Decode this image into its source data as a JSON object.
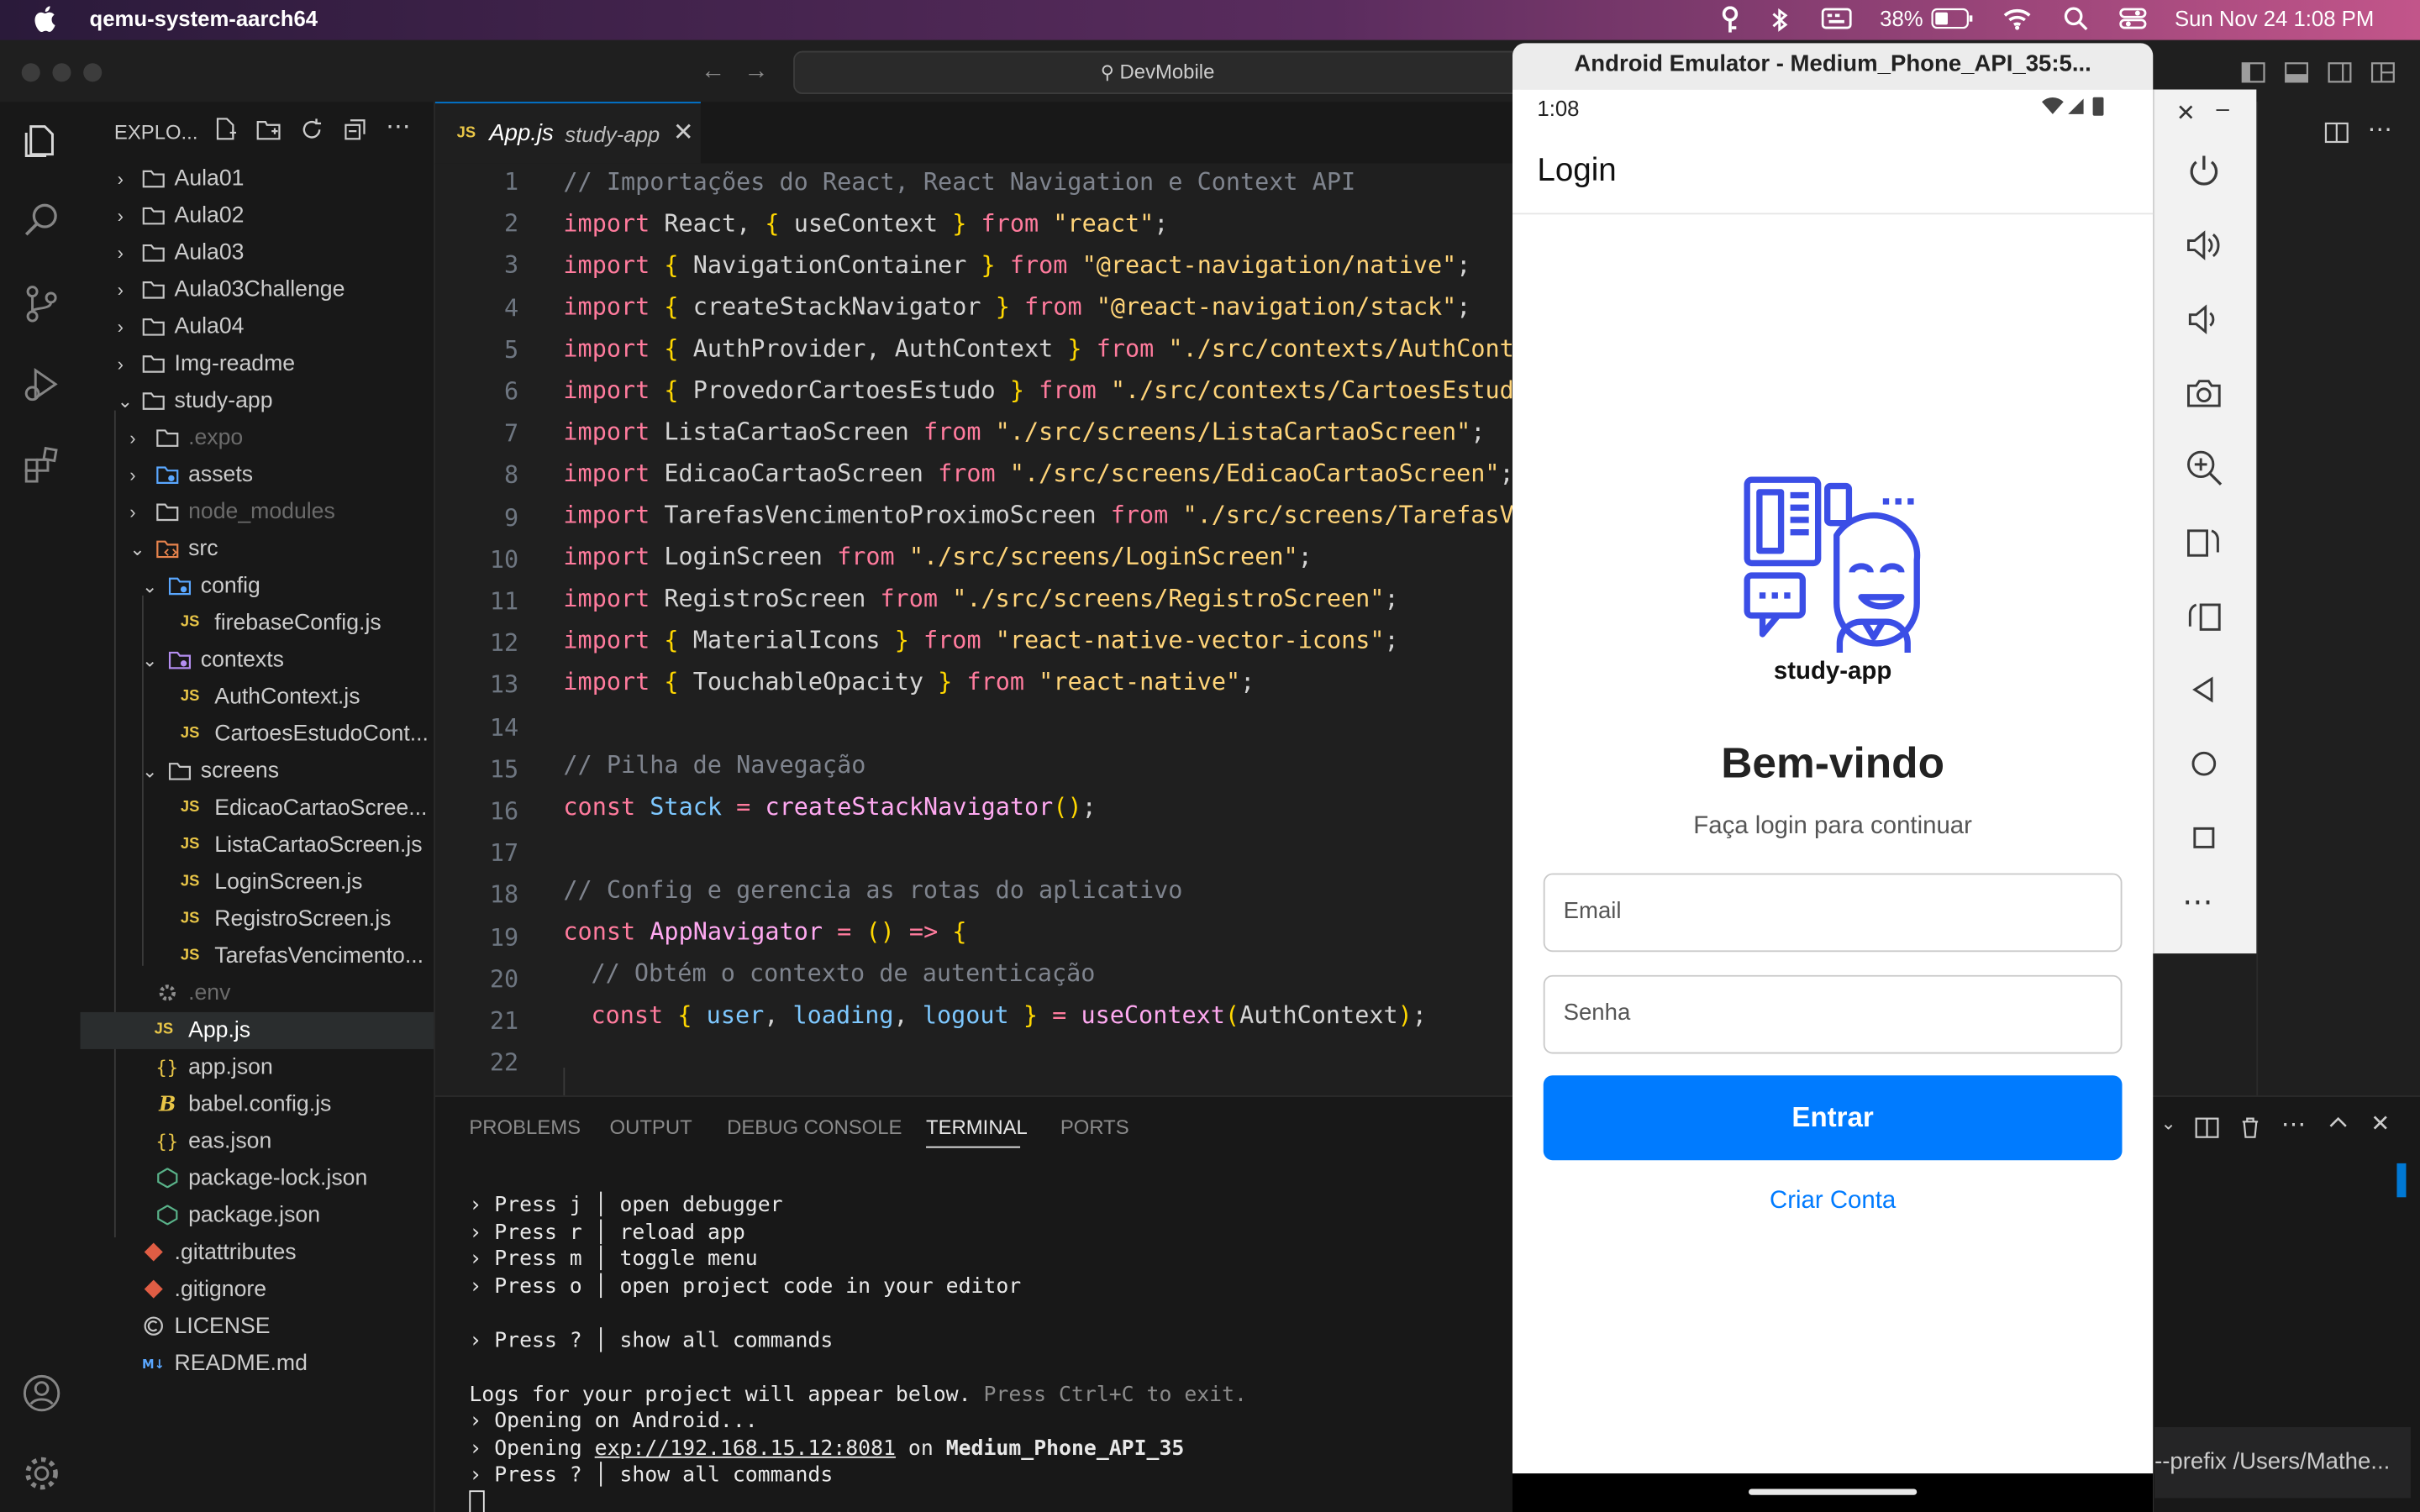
{
  "menubar": {
    "app_name": "qemu-system-aarch64",
    "battery": "38%",
    "clock": "Sun Nov 24  1:08 PM"
  },
  "vscode": {
    "command_center": "DevMobile",
    "explorer_header": "EXPLO...",
    "tree": [
      {
        "label": "Aula01"
      },
      {
        "label": "Aula02"
      },
      {
        "label": "Aula03"
      },
      {
        "label": "Aula03Challenge"
      },
      {
        "label": "Aula04"
      },
      {
        "label": "Img-readme"
      },
      {
        "label": "study-app"
      },
      {
        "label": ".expo"
      },
      {
        "label": "assets"
      },
      {
        "label": "node_modules"
      },
      {
        "label": "src"
      },
      {
        "label": "config"
      },
      {
        "label": "firebaseConfig.js"
      },
      {
        "label": "contexts"
      },
      {
        "label": "AuthContext.js"
      },
      {
        "label": "CartoesEstudoCont..."
      },
      {
        "label": "screens"
      },
      {
        "label": "EdicaoCartaoScree..."
      },
      {
        "label": "ListaCartaoScreen.js"
      },
      {
        "label": "LoginScreen.js"
      },
      {
        "label": "RegistroScreen.js"
      },
      {
        "label": "TarefasVencimento..."
      },
      {
        "label": ".env"
      },
      {
        "label": "App.js"
      },
      {
        "label": "app.json"
      },
      {
        "label": "babel.config.js"
      },
      {
        "label": "eas.json"
      },
      {
        "label": "package-lock.json"
      },
      {
        "label": "package.json"
      },
      {
        "label": ".gitattributes"
      },
      {
        "label": ".gitignore"
      },
      {
        "label": "LICENSE"
      },
      {
        "label": "README.md"
      }
    ],
    "tab": {
      "name": "App.js",
      "folder": "study-app",
      "badge": "JS"
    },
    "line_numbers": [
      "1",
      "2",
      "3",
      "4",
      "5",
      "6",
      "7",
      "8",
      "9",
      "10",
      "11",
      "12",
      "13",
      "14",
      "15",
      "16",
      "17",
      "18",
      "19",
      "20",
      "21",
      "22"
    ],
    "code": {
      "l1": "// Importações do React, React Navigation e Context API",
      "l2a": "import",
      "l2b": " React, ",
      "l2c": "{",
      "l2d": " useContext ",
      "l2e": "}",
      "l2f": " from ",
      "l2g": "\"react\"",
      "l2h": ";",
      "l3": "\"@react-navigation/native\"",
      "l4": "\"@react-navigation/stack\"",
      "l5": "\"./src/contexts/AuthContex",
      "l6": "\"./src/contexts/CartoesEstudoC",
      "l7": "\"./src/screens/ListaCartaoScreen\"",
      "l8": "\"./src/screens/EdicaoCartaoScreen\"",
      "l9": "\"./src/screens/TarefasVen",
      "l10": "\"./src/screens/LoginScreen\"",
      "l11": "\"./src/screens/RegistroScreen\"",
      "l12": "\"react-native-vector-icons\"",
      "l13": "\"react-native\"",
      "l15": "// Pilha de Navegação",
      "l18": "// Config e gerencia as rotas do aplicativo",
      "l20": "// Obtém o contexto de autenticação"
    },
    "panel_tabs": [
      "PROBLEMS",
      "OUTPUT",
      "DEBUG CONSOLE",
      "TERMINAL",
      "PORTS"
    ],
    "terminal": {
      "t1": "› Press j │ open debugger",
      "t2": "› Press r │ reload app",
      "t3": "› Press m │ toggle menu",
      "t4": "› Press o │ open project code in your editor",
      "t5": "› Press ? │ show all commands",
      "t6a": "Logs for your project will appear below. ",
      "t6b": "Press Ctrl+C to exit.",
      "t7": "› Opening on Android...",
      "t8a": "› Opening ",
      "t8b": "exp://192.168.15.12:8081",
      "t8c": " on ",
      "t8d": "Medium_Phone_API_35",
      "t9": "› Press ? │ show all commands"
    },
    "side_snippet": "--prefix /Users/Mathe..."
  },
  "emulator": {
    "title": "Android Emulator - Medium_Phone_API_35:5...",
    "status_time": "1:08",
    "app_header": "Login",
    "logo_caption": "study-app",
    "welcome": "Bem-vindo",
    "subtitle": "Faça login para continuar",
    "email_placeholder": "Email",
    "password_placeholder": "Senha",
    "login_button": "Entrar",
    "create_account": "Criar Conta",
    "accent": "#007bff"
  }
}
